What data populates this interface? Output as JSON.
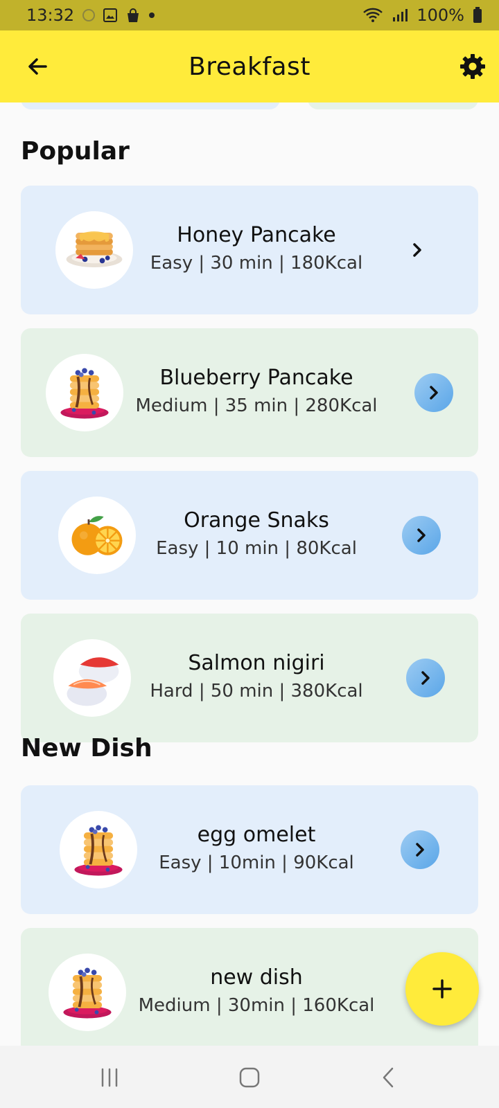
{
  "status_bar": {
    "time": "13:32",
    "battery": "100%"
  },
  "app_bar": {
    "title": "Breakfast",
    "back_icon": "arrow-left-icon",
    "settings_icon": "gear-icon"
  },
  "sections": {
    "popular": {
      "title": "Popular",
      "items": [
        {
          "name": "Honey Pancake",
          "meta": "Easy | 30 min | 180Kcal",
          "image": "honey-pancake-icon"
        },
        {
          "name": "Blueberry Pancake",
          "meta": "Medium | 35 min | 280Kcal",
          "image": "blueberry-pancake-icon"
        },
        {
          "name": "Orange Snaks",
          "meta": "Easy | 10 min | 80Kcal",
          "image": "orange-icon"
        },
        {
          "name": "Salmon nigiri",
          "meta": "Hard | 50 min | 380Kcal",
          "image": "salmon-nigiri-icon"
        }
      ]
    },
    "new_dish": {
      "title": "New Dish",
      "items": [
        {
          "name": "egg omelet",
          "meta": "Easy | 10min | 90Kcal",
          "image": "pancake-stack-icon"
        },
        {
          "name": "new dish",
          "meta": "Medium | 30min | 160Kcal",
          "image": "pancake-stack-icon"
        }
      ]
    }
  },
  "fab": {
    "icon": "plus-icon"
  },
  "colors": {
    "app_bar": "#ffeb3b",
    "status_bar": "#c1b22b",
    "card_blue": "#e3eefb",
    "card_green": "#e6f2e7",
    "arrow_button": "#5aa6e8"
  }
}
